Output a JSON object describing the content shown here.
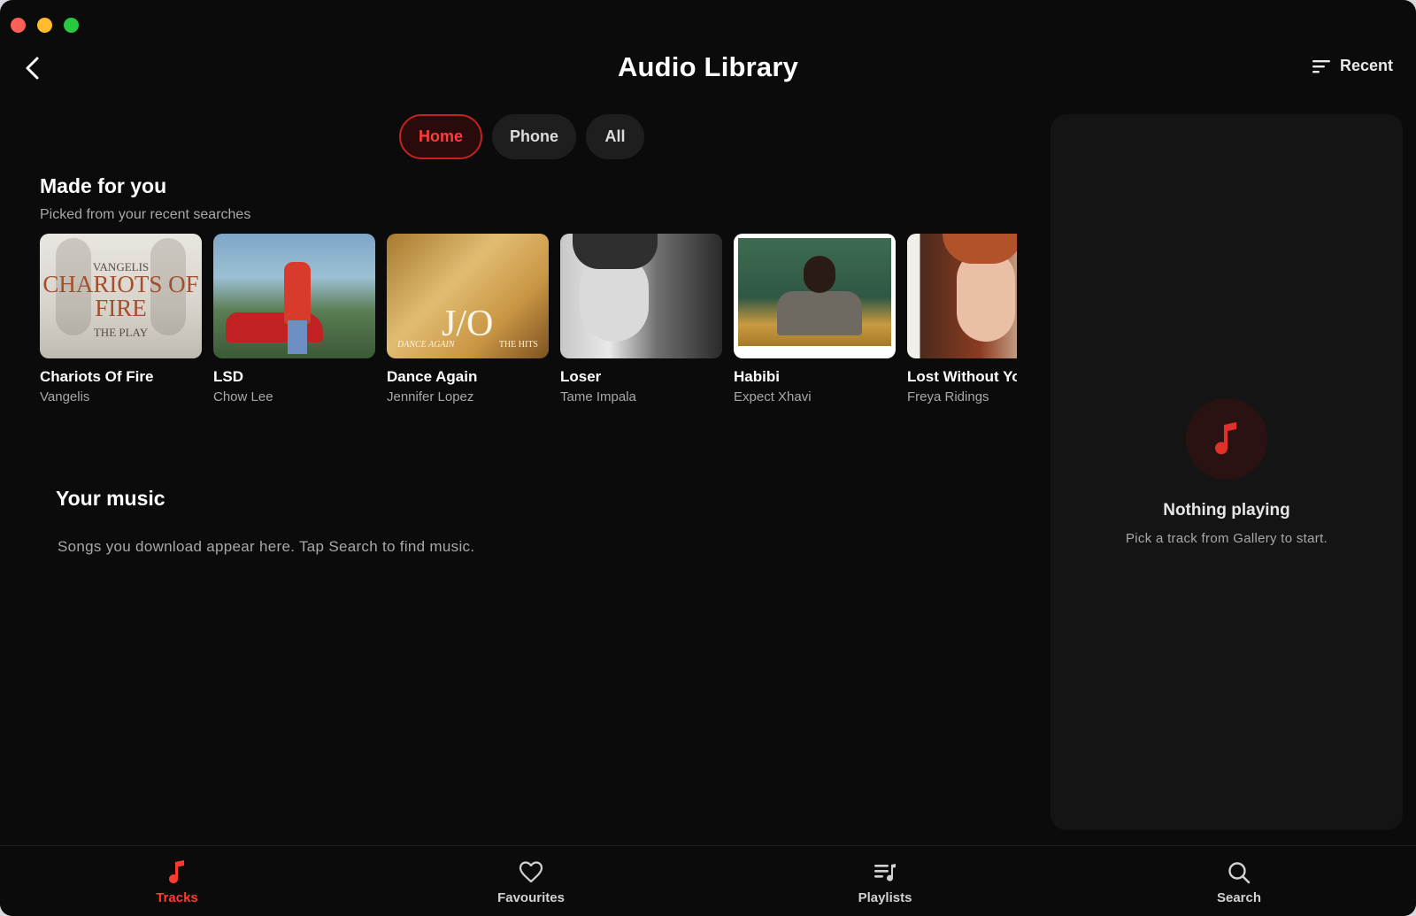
{
  "window": {
    "title": "Audio Library"
  },
  "header": {
    "sort_label": "Recent"
  },
  "tabs": [
    {
      "label": "Home",
      "active": true
    },
    {
      "label": "Phone",
      "active": false
    },
    {
      "label": "All",
      "active": false
    }
  ],
  "made_for_you": {
    "title": "Made for you",
    "subtitle": "Picked from your recent searches",
    "items": [
      {
        "title": "Chariots Of Fire",
        "artist": "Vangelis",
        "cover_text_top": "VANGELIS",
        "cover_text_main": "CHARIOTS OF FIRE",
        "cover_text_bottom": "THE PLAY"
      },
      {
        "title": "LSD",
        "artist": "Chow Lee"
      },
      {
        "title": "Dance Again",
        "artist": "Jennifer Lopez",
        "cover_text_main": "J/O",
        "cover_text_left": "DANCE AGAIN",
        "cover_text_right": "THE HITS"
      },
      {
        "title": "Loser",
        "artist": "Tame Impala"
      },
      {
        "title": "Habibi",
        "artist": "Expect Xhavi"
      },
      {
        "title": "Lost Without You",
        "artist": "Freya Ridings"
      }
    ]
  },
  "your_music": {
    "title": "Your music",
    "empty_text": "Songs you download appear here. Tap Search to find music."
  },
  "now_playing": {
    "title": "Nothing playing",
    "subtitle": "Pick a track from Gallery to start."
  },
  "bottom_nav": [
    {
      "label": "Tracks",
      "icon": "music-note-icon",
      "active": true
    },
    {
      "label": "Favourites",
      "icon": "heart-icon",
      "active": false
    },
    {
      "label": "Playlists",
      "icon": "playlist-icon",
      "active": false
    },
    {
      "label": "Search",
      "icon": "search-icon",
      "active": false
    }
  ],
  "colors": {
    "accent": "#ff3b30",
    "background": "#0b0b0b",
    "panel": "#141414"
  }
}
